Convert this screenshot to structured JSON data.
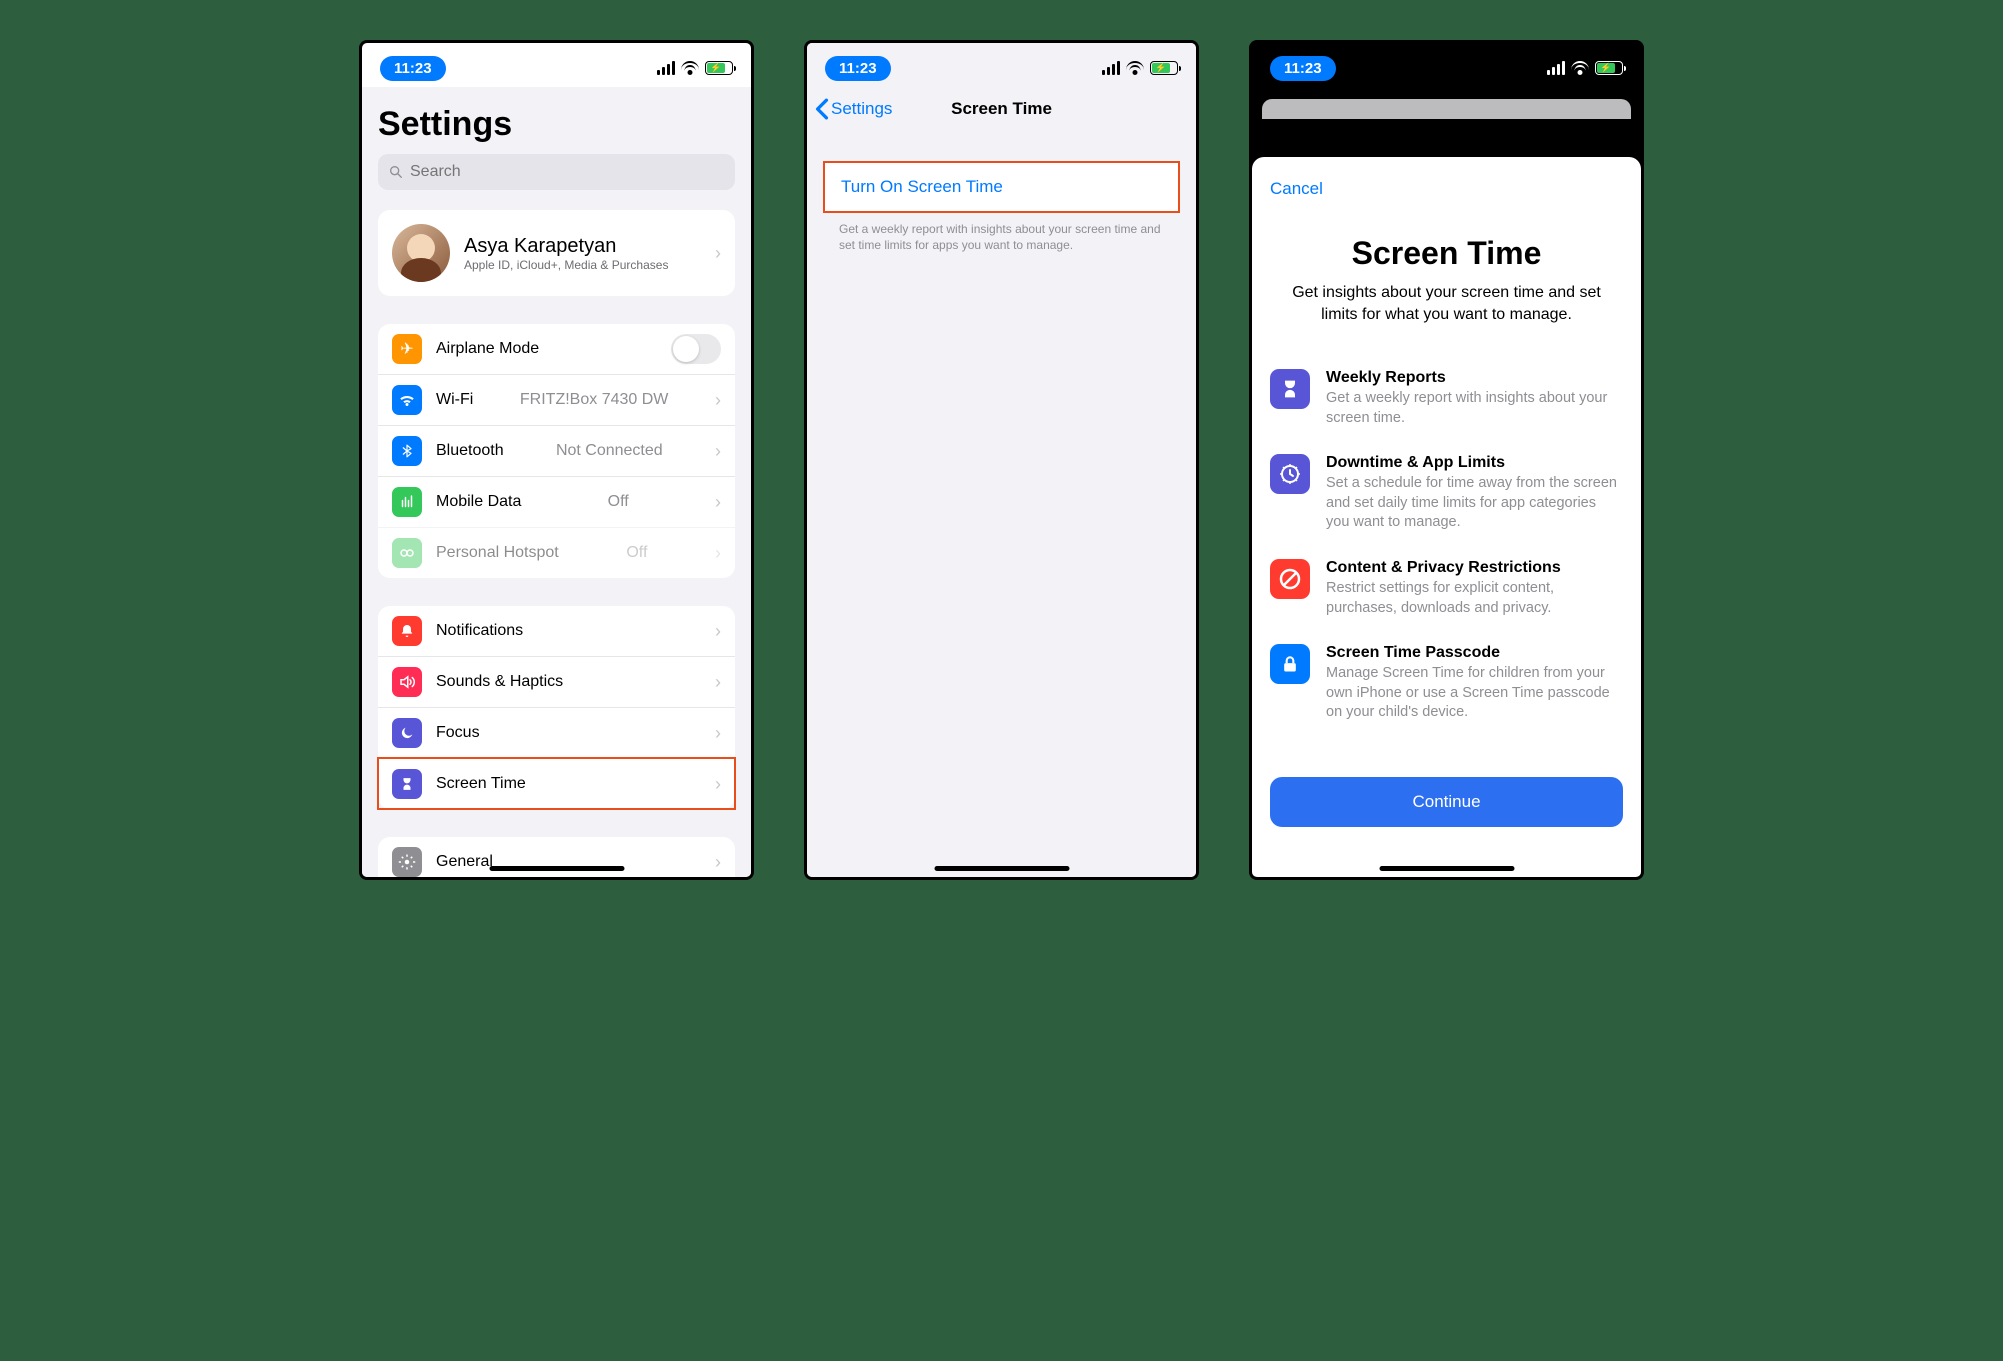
{
  "status": {
    "time": "11:23"
  },
  "phone1": {
    "title": "Settings",
    "search_placeholder": "Search",
    "profile": {
      "name": "Asya Karapetyan",
      "sub": "Apple ID, iCloud+, Media & Purchases"
    },
    "group1": {
      "airplane": "Airplane Mode",
      "wifi": "Wi-Fi",
      "wifi_val": "FRITZ!Box 7430 DW",
      "bluetooth": "Bluetooth",
      "bluetooth_val": "Not Connected",
      "mobile": "Mobile Data",
      "mobile_val": "Off",
      "hotspot": "Personal Hotspot",
      "hotspot_val": "Off"
    },
    "group2": {
      "notifications": "Notifications",
      "sounds": "Sounds & Haptics",
      "focus": "Focus",
      "screentime": "Screen Time"
    },
    "group3": {
      "general": "General"
    }
  },
  "phone2": {
    "back": "Settings",
    "title": "Screen Time",
    "turn_on": "Turn On Screen Time",
    "footer": "Get a weekly report with insights about your screen time and set time limits for apps you want to manage."
  },
  "phone3": {
    "cancel": "Cancel",
    "title": "Screen Time",
    "sub": "Get insights about your screen time and set limits for what you want to manage.",
    "features": {
      "weekly_t": "Weekly Reports",
      "weekly_d": "Get a weekly report with insights about your screen time.",
      "downtime_t": "Downtime & App Limits",
      "downtime_d": "Set a schedule for time away from the screen and set daily time limits for app categories you want to manage.",
      "content_t": "Content & Privacy Restrictions",
      "content_d": "Restrict settings for explicit content, purchases, downloads and privacy.",
      "passcode_t": "Screen Time Passcode",
      "passcode_d": "Manage Screen Time for children from your own iPhone or use a Screen Time passcode on your child's device."
    },
    "continue": "Continue"
  }
}
